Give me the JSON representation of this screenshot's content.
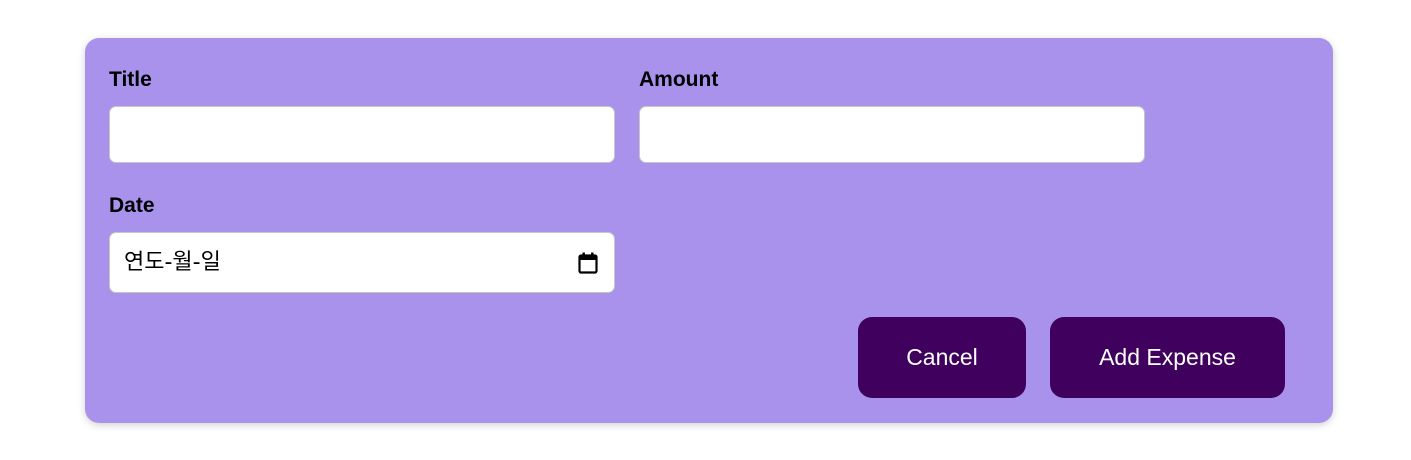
{
  "form": {
    "title": {
      "label": "Title",
      "value": ""
    },
    "amount": {
      "label": "Amount",
      "value": ""
    },
    "date": {
      "label": "Date",
      "placeholder_text": "연도-월-일"
    }
  },
  "actions": {
    "cancel_label": "Cancel",
    "add_label": "Add Expense"
  },
  "colors": {
    "card_background": "#a992ec",
    "button_background": "#40005e",
    "button_text": "#ffffff",
    "input_background": "#ffffff"
  },
  "icons": {
    "date_picker": "calendar-icon"
  }
}
